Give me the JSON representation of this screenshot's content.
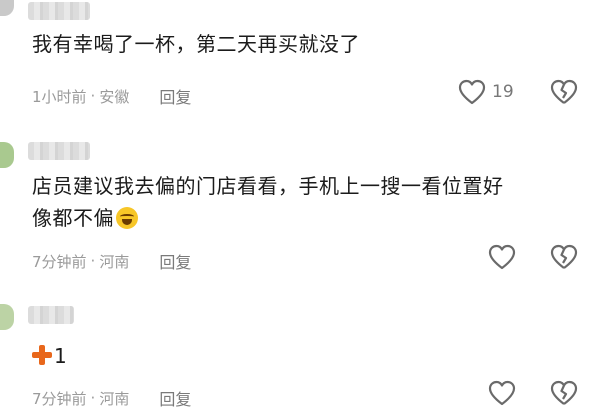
{
  "comments": [
    {
      "text": "我有幸喝了一杯，第二天再买就没了",
      "time": "1小时前",
      "location": "安徽",
      "reply_label": "回复",
      "likes": "19",
      "avatar_color": "#c9c9c9"
    },
    {
      "text_line1": "店员建议我去偏的门店看看，手机上一搜一看位置好",
      "text_line2": "像都不偏",
      "emoji_icon": "laughing-crying-emoji-icon",
      "time": "7分钟前",
      "location": "河南",
      "reply_label": "回复",
      "likes": "",
      "avatar_color": "#a9c98f"
    },
    {
      "text_prefix_icon": "plus-icon",
      "text": "1",
      "time": "7分钟前",
      "location": "河南",
      "reply_label": "回复",
      "likes": "",
      "avatar_color": "#bcd3a5"
    }
  ],
  "colors": {
    "plus": "#e8671b",
    "meta": "#9a9a9a"
  }
}
